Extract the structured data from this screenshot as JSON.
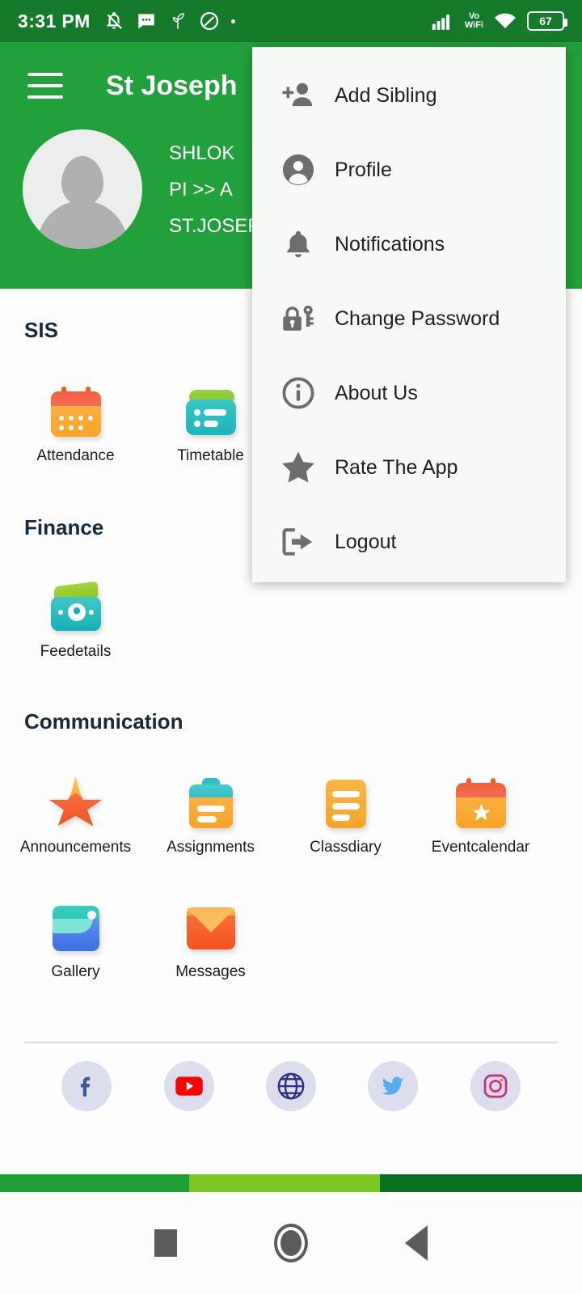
{
  "statusbar": {
    "time": "3:31 PM",
    "left_icons": [
      "bell-off-icon",
      "message-icon",
      "leaf-icon",
      "do-not-disturb-icon",
      "dot-icon"
    ],
    "network_label": "Vo",
    "network_label2": "WiFi",
    "battery_percent": "67",
    "right_icons": [
      "signal-icon",
      "vowifi-icon",
      "wifi-icon",
      "battery-icon"
    ],
    "background": "#167a2b"
  },
  "header": {
    "title": "St Joseph",
    "menu_icon": "hamburger-icon",
    "background": "#22a03b",
    "profile": {
      "name": "SHLOK",
      "class": "PI >> A",
      "school": "ST.JOSEP",
      "avatar_icon": "person-placeholder-icon"
    }
  },
  "sections": [
    {
      "title": "SIS",
      "tiles": [
        {
          "label": "Attendance",
          "icon": "calendar-icon"
        },
        {
          "label": "Timetable",
          "icon": "timetable-card-icon"
        }
      ]
    },
    {
      "title": "Finance",
      "tiles": [
        {
          "label": "Feedetails",
          "icon": "wallet-money-icon"
        }
      ]
    },
    {
      "title": "Communication",
      "tiles": [
        {
          "label": "Announcements",
          "icon": "star-announcement-icon"
        },
        {
          "label": "Assignments",
          "icon": "clipboard-icon"
        },
        {
          "label": "Classdiary",
          "icon": "document-icon"
        },
        {
          "label": "Eventcalendar",
          "icon": "calendar-star-icon"
        },
        {
          "label": "Gallery",
          "icon": "gallery-image-icon"
        },
        {
          "label": "Messages",
          "icon": "envelope-icon"
        }
      ]
    }
  ],
  "social": [
    {
      "name": "facebook-icon",
      "glyph": "f",
      "color": "#3b5998"
    },
    {
      "name": "youtube-icon",
      "glyph": "▶",
      "color": "#ff0000"
    },
    {
      "name": "website-globe-icon",
      "glyph": "⊕",
      "color": "#2d2f7f"
    },
    {
      "name": "twitter-icon",
      "glyph": "ᵇ",
      "color": "#55acee"
    },
    {
      "name": "instagram-icon",
      "glyph": "◎",
      "color": "#c13584"
    }
  ],
  "menu": {
    "items": [
      {
        "label": "Add Sibling",
        "icon": "add-person-icon"
      },
      {
        "label": "Profile",
        "icon": "profile-circle-icon"
      },
      {
        "label": "Notifications",
        "icon": "bell-icon"
      },
      {
        "label": "Change Password",
        "icon": "lock-key-icon"
      },
      {
        "label": "About Us",
        "icon": "info-circle-icon"
      },
      {
        "label": "Rate The App",
        "icon": "star-icon"
      },
      {
        "label": "Logout",
        "icon": "logout-arrow-icon"
      }
    ],
    "background": "#f7f9f7"
  },
  "colorbar": {
    "segments": [
      "#1f9e36",
      "#7ac624",
      "#0a7021"
    ]
  },
  "navbar": {
    "buttons": [
      "recents-square-icon",
      "home-circle-icon",
      "back-triangle-icon"
    ]
  }
}
